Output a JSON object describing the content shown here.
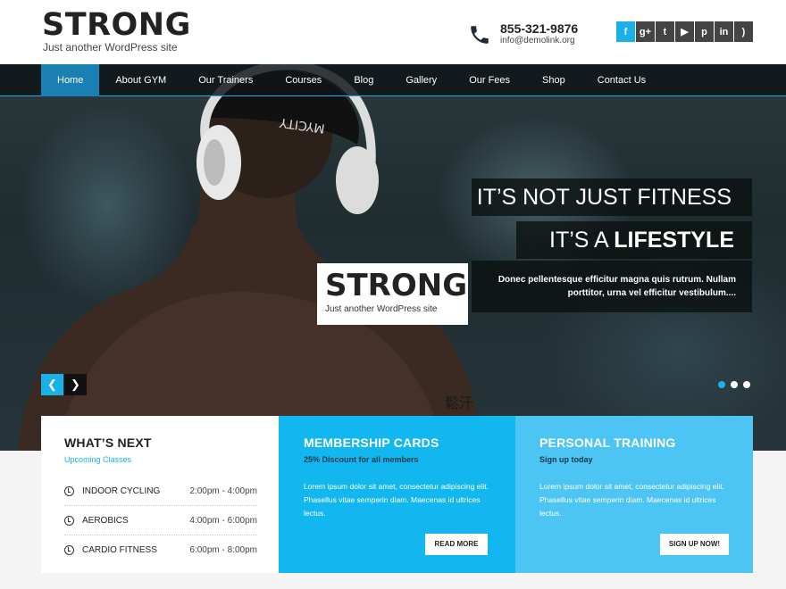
{
  "header": {
    "title": "STRONG",
    "tagline": "Just another WordPress site",
    "phone": "855-321-9876",
    "email": "info@demolink.org",
    "social": [
      {
        "icon": "facebook-icon",
        "glyph": "f"
      },
      {
        "icon": "google-plus-icon",
        "glyph": "g+"
      },
      {
        "icon": "twitter-icon",
        "glyph": "t"
      },
      {
        "icon": "youtube-icon",
        "glyph": "▶"
      },
      {
        "icon": "pinterest-icon",
        "glyph": "p"
      },
      {
        "icon": "linkedin-icon",
        "glyph": "in"
      },
      {
        "icon": "rss-icon",
        "glyph": ")"
      }
    ]
  },
  "nav": {
    "items": [
      "Home",
      "About GYM",
      "Our Trainers",
      "Courses",
      "Blog",
      "Gallery",
      "Our Fees",
      "Shop",
      "Contact Us"
    ],
    "active": "Home"
  },
  "hero": {
    "line1": "IT’S NOT JUST FITNESS",
    "line2_prefix": "IT’S A ",
    "line2_bold": "LIFESTYLE",
    "text": "Donec pellentesque efficitur magna quis rutrum. Nullam porttitor, urna vel efficitur vestibulum....",
    "logo_title": "STRONG",
    "logo_tagline": "Just another WordPress site",
    "slides": 3,
    "active_slide": 1
  },
  "whats_next": {
    "title": "WHAT’S NEXT",
    "subtitle": "Upcoming Classes",
    "classes": [
      {
        "name": "INDOOR CYCLING",
        "time": "2:00pm - 4:00pm"
      },
      {
        "name": "AEROBICS",
        "time": "4:00pm - 6:00pm"
      },
      {
        "name": "CARDIO FITNESS",
        "time": "6:00pm - 8:00pm"
      }
    ]
  },
  "membership": {
    "title": "MEMBERSHIP CARDS",
    "subtitle": "25% Discount for all members",
    "text": "Lorem ipsum dolor sit amet, consectetur adipiscing elit. Phasellus vitae semperin diam. Maecenas id ultrices lectus.",
    "button": "READ MORE"
  },
  "training": {
    "title": "PERSONAL TRAINING",
    "subtitle": "Sign up today",
    "text": "Lorem ipsum dolor sit amet, consectetur adipiscing elit. Phasellus vitae semperin diam. Maecenas id ultrices lectus.",
    "button": "SIGN UP NOW!"
  },
  "colors": {
    "accent": "#1ab1e6",
    "membership_bg": "#13b7ef",
    "training_bg": "#4cc5f5"
  }
}
